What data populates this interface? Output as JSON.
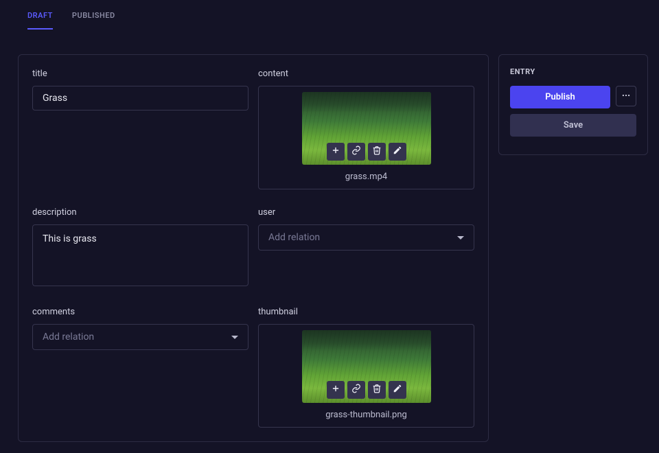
{
  "tabs": {
    "draft": "DRAFT",
    "published": "PUBLISHED"
  },
  "sidebar": {
    "heading": "ENTRY",
    "publish_label": "Publish",
    "save_label": "Save"
  },
  "fields": {
    "title": {
      "label": "title",
      "value": "Grass"
    },
    "content": {
      "label": "content",
      "filename": "grass.mp4"
    },
    "description": {
      "label": "description",
      "value": "This is grass"
    },
    "user": {
      "label": "user",
      "placeholder": "Add relation"
    },
    "comments": {
      "label": "comments",
      "placeholder": "Add relation"
    },
    "thumbnail": {
      "label": "thumbnail",
      "filename": "grass-thumbnail.png"
    }
  }
}
